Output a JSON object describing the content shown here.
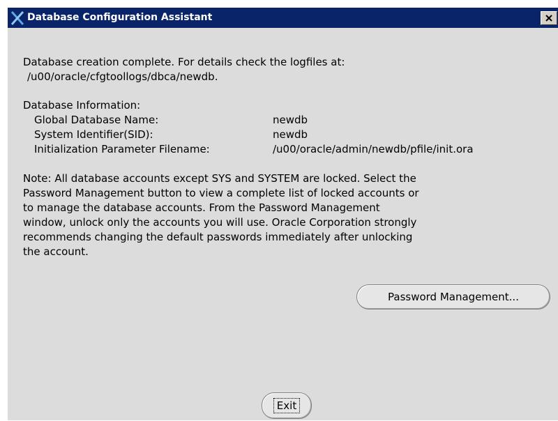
{
  "window": {
    "title": "Database Configuration Assistant",
    "icon": "oracle-x-icon",
    "close_icon": "close-icon"
  },
  "message": {
    "completion_line1": "Database creation complete. For details check the logfiles at:",
    "completion_line2": "/u00/oracle/cfgtoollogs/dbca/newdb.",
    "info_heading": "Database Information:",
    "info_rows": [
      {
        "label": "Global Database Name:",
        "value": "newdb"
      },
      {
        "label": "System Identifier(SID):",
        "value": "newdb"
      },
      {
        "label": "Initialization Parameter Filename:",
        "value": "/u00/oracle/admin/newdb/pfile/init.ora"
      }
    ],
    "note_lines": [
      "Note: All database accounts except SYS and SYSTEM are locked. Select the",
      "Password Management button to view a complete list of locked accounts or",
      "to manage the database accounts. From the Password Management",
      "window, unlock only the accounts you will use. Oracle Corporation strongly",
      "recommends changing the default passwords immediately after unlocking",
      "the account."
    ]
  },
  "buttons": {
    "password_management": "Password Management...",
    "exit": "Exit"
  },
  "colors": {
    "titlebar": "#0a246a",
    "dialog_background": "#dcdcdc",
    "icon_accent": "#5fa8e8"
  }
}
